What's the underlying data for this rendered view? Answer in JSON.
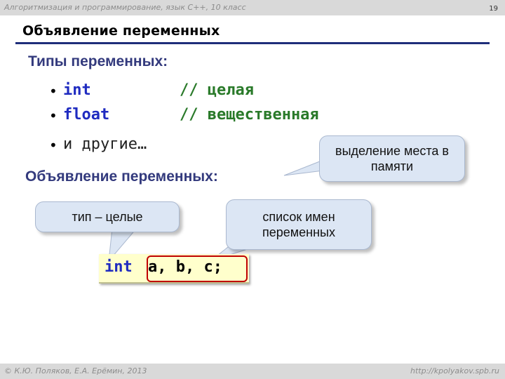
{
  "header": {
    "course": "Алгоритмизация и программирование, язык  C++, 10 класс",
    "page_number": "19"
  },
  "slide": {
    "title": "Объявление  переменных",
    "types_heading": "Типы переменных:",
    "types": [
      {
        "keyword": "int",
        "comment": "// целая"
      },
      {
        "keyword": "float",
        "comment": "// вещественная"
      }
    ],
    "others": "и другие…",
    "decl_heading": "Объявление переменных:",
    "callouts": {
      "memory": "выделение места в памяти",
      "type_int": "тип – целые",
      "names": "список имен переменных"
    },
    "code": {
      "keyword": "int",
      "vars": "a, b, c;"
    }
  },
  "footer": {
    "authors": "© К.Ю. Поляков, Е.А. Ерёмин, 2013",
    "url": "http://kpolyakov.spb.ru"
  },
  "colors": {
    "keyword": "#1f2bc0",
    "comment": "#2a7a2a",
    "heading": "#333a7d",
    "callout_fill": "#dce6f4",
    "code_fill": "#ffffcc",
    "highlight_frame": "#c00000"
  }
}
